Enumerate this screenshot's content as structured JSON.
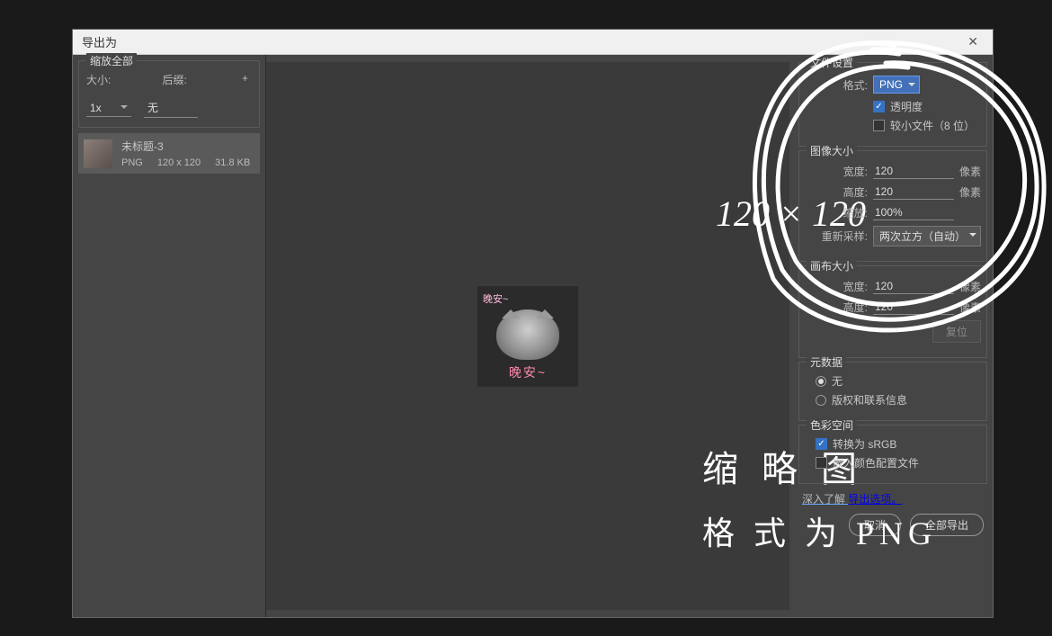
{
  "dialog": {
    "title": "导出为"
  },
  "scale_all": {
    "legend": "缩放全部",
    "size_header": "大小:",
    "suffix_header": "后缀:",
    "scale_value": "1x",
    "suffix_value": "无",
    "add_icon": "+"
  },
  "asset": {
    "name": "未标题-3",
    "format": "PNG",
    "dimensions": "120 x 120",
    "filesize": "31.8 KB",
    "overlay_top": "晚安~",
    "overlay_bottom": "晚安~"
  },
  "annotations": {
    "size": "120 × 120",
    "line2": "缩 略 图",
    "line3": "格 式 为 PNG"
  },
  "file_settings": {
    "legend": "文件设置",
    "format_label": "格式:",
    "format_value": "PNG",
    "transparency": "透明度",
    "smaller_file": "较小文件（8 位）"
  },
  "image_size": {
    "legend": "图像大小",
    "width_label": "宽度:",
    "width_value": "120",
    "height_label": "高度:",
    "height_value": "120",
    "scale_label": "缩放:",
    "scale_value": "100%",
    "resample_label": "重新采样:",
    "resample_value": "两次立方（自动）",
    "unit": "像素"
  },
  "canvas_size": {
    "legend": "画布大小",
    "width_label": "宽度:",
    "width_value": "120",
    "height_label": "高度:",
    "height_value": "120",
    "unit": "像素",
    "reset": "复位"
  },
  "metadata": {
    "legend": "元数据",
    "none": "无",
    "copyright": "版权和联系信息"
  },
  "colorspace": {
    "legend": "色彩空间",
    "convert_srgb": "转换为 sRGB",
    "embed_profile": "嵌入颜色配置文件"
  },
  "footer": {
    "learn_pre": "深入了解 ",
    "learn_link": "导出选项。",
    "cancel": "取消",
    "export_all": "全部导出"
  }
}
